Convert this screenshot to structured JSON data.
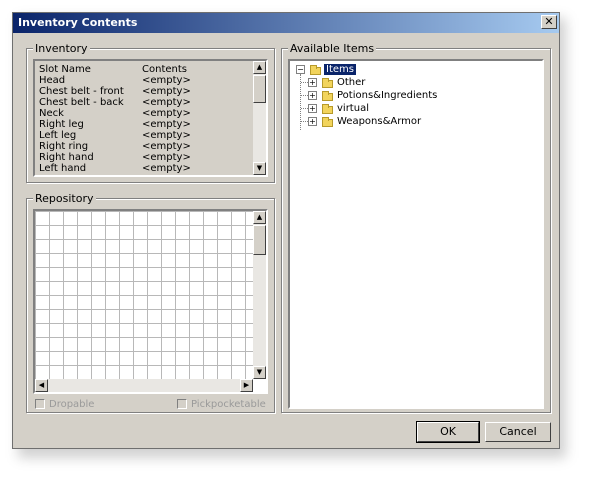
{
  "window": {
    "title": "Inventory Contents",
    "close_glyph": "✕"
  },
  "inventory": {
    "legend": "Inventory",
    "headers": {
      "slot": "Slot Name",
      "contents": "Contents"
    },
    "rows": [
      {
        "slot": "Head",
        "contents": "<empty>"
      },
      {
        "slot": "Chest belt - front",
        "contents": "<empty>"
      },
      {
        "slot": "Chest belt - back",
        "contents": "<empty>"
      },
      {
        "slot": "Neck",
        "contents": "<empty>"
      },
      {
        "slot": "Right leg",
        "contents": "<empty>"
      },
      {
        "slot": "Left leg",
        "contents": "<empty>"
      },
      {
        "slot": "Right ring",
        "contents": "<empty>"
      },
      {
        "slot": "Right hand",
        "contents": "<empty>"
      },
      {
        "slot": "Left hand",
        "contents": "<empty>"
      }
    ]
  },
  "repository": {
    "legend": "Repository",
    "dropable": {
      "label": "Dropable",
      "checked": false,
      "enabled": false
    },
    "pickpocketable": {
      "label": "Pickpocketable",
      "checked": false,
      "enabled": false
    }
  },
  "available": {
    "legend": "Available Items",
    "root": "Items",
    "children": [
      "Other",
      "Potions&Ingredients",
      "virtual",
      "Weapons&Armor"
    ]
  },
  "buttons": {
    "ok": "OK",
    "cancel": "Cancel"
  },
  "icons": {
    "close": "close-icon",
    "folder": "folder-icon",
    "expand": "expand-plus-icon",
    "collapse": "collapse-minus-icon",
    "scroll_up": "scroll-up-arrow-icon",
    "scroll_down": "scroll-down-arrow-icon",
    "scroll_left": "scroll-left-arrow-icon",
    "scroll_right": "scroll-right-arrow-icon"
  }
}
